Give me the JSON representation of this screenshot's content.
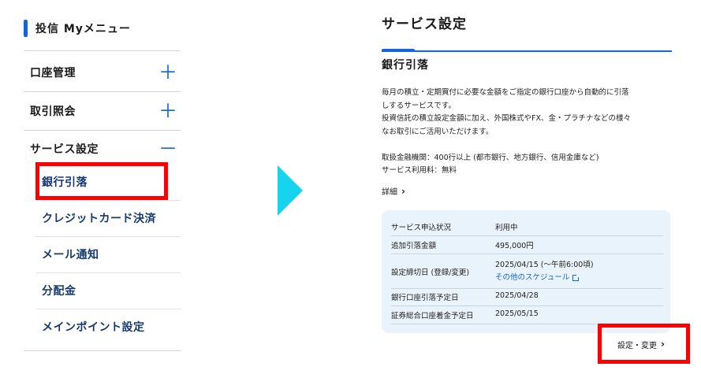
{
  "left_menu": {
    "title": "投信 Myメニュー",
    "categories": [
      {
        "label": "口座管理",
        "sign": "＋"
      },
      {
        "label": "取引照会",
        "sign": "＋"
      },
      {
        "label": "サービス設定",
        "sign": "－"
      }
    ],
    "sub_items": [
      {
        "label": "銀行引落"
      },
      {
        "label": "クレジットカード決済"
      },
      {
        "label": "メール通知"
      },
      {
        "label": "分配金"
      },
      {
        "label": "メインポイント設定"
      }
    ]
  },
  "right_panel": {
    "page_title": "サービス設定",
    "section_title": "銀行引落",
    "description": [
      "毎月の積立・定期買付に必要な金額をご指定の銀行口座から自動的に引落",
      "しするサービスです。",
      "投資信託の積立設定金額に加え、外国株式やFX、金・プラチナなどの様々",
      "なお取引にご活用いただけます。",
      "",
      "取扱金融機関：400行以上 (都市銀行、地方銀行、信用金庫など)",
      "サービス利用料：無料"
    ],
    "detail_link": "詳細",
    "info": {
      "status_label": "サービス申込状況",
      "status_value": "利用中",
      "amount_label": "追加引落金額",
      "amount_value": "495,000円",
      "deadline_label": "設定締切日 (登録/変更)",
      "deadline_value": "2025/04/15 (〜午前6:00頃)",
      "schedule_link": "その他のスケジュール",
      "withdraw_label": "銀行口座引落予定日",
      "withdraw_value": "2025/04/28",
      "deposit_label": "証券総合口座着金予定日",
      "deposit_value": "2025/05/15"
    },
    "settings_button": "設定・変更"
  },
  "colors": {
    "accent": "#1565d8",
    "highlight_box": "#ff0000",
    "arrow": "#16d4ee",
    "info_bg": "#e9f3fb"
  }
}
